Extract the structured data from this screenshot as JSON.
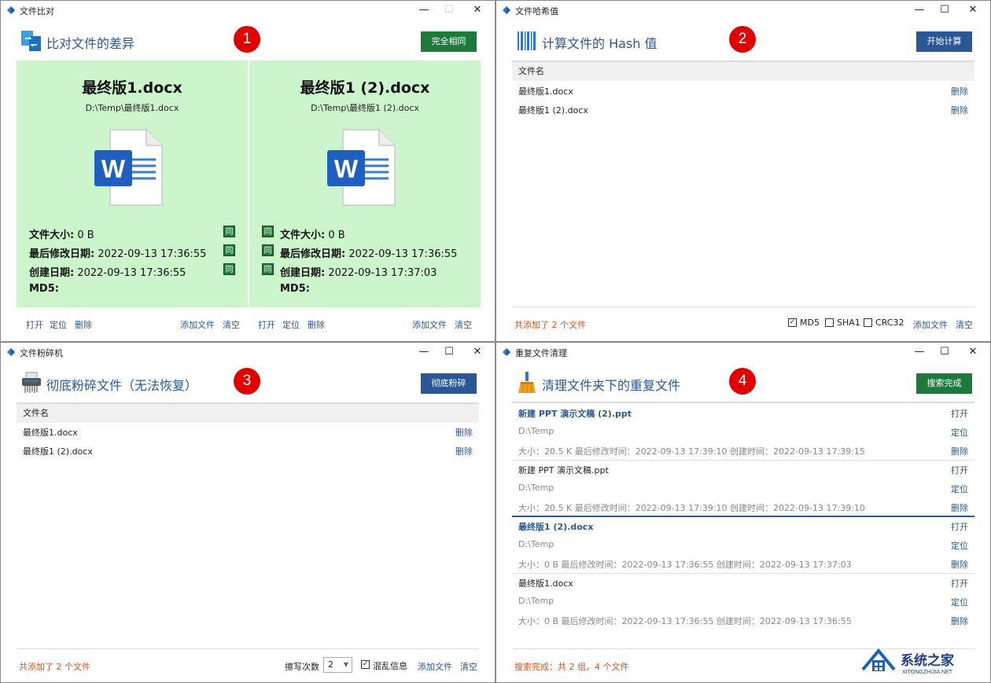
{
  "w1": {
    "title": "文件比对",
    "heading": "比对文件的差异",
    "badge": "1",
    "button": "完全相同",
    "left": {
      "file_name": "最终版1.docx",
      "path": "D:\\Temp\\最终版1.docx",
      "size_label": "文件大小:",
      "size_value": "0 B",
      "modified_label": "最后修改日期:",
      "modified_value": "2022-09-13  17:36:55",
      "created_label": "创建日期:",
      "created_value": "2022-09-13  17:36:55",
      "md5_label": "MD5:"
    },
    "right": {
      "file_name": "最终版1 (2).docx",
      "path": "D:\\Temp\\最终版1 (2).docx",
      "size_label": "文件大小:",
      "size_value": "0 B",
      "modified_label": "最后修改日期:",
      "modified_value": "2022-09-13  17:36:55",
      "created_label": "创建日期:",
      "created_value": "2022-09-13  17:37:03",
      "md5_label": "MD5:"
    },
    "same_mark": "同",
    "links": {
      "open": "打开",
      "locate": "定位",
      "delete": "删除",
      "add": "添加文件",
      "clear": "清空"
    }
  },
  "w2": {
    "title": "文件哈希值",
    "heading": "计算文件的 Hash 值",
    "badge": "2",
    "button": "开始计算",
    "column": "文件名",
    "rows": [
      "最终版1.docx",
      "最终版1 (2).docx"
    ],
    "delete": "删除",
    "status": "共添加了 2 个文件",
    "checks": [
      "MD5",
      "SHA1",
      "CRC32"
    ],
    "add": "添加文件",
    "clear": "清空"
  },
  "w3": {
    "title": "文件粉碎机",
    "heading": "彻底粉碎文件（无法恢复）",
    "badge": "3",
    "button": "彻底粉碎",
    "column": "文件名",
    "rows": [
      "最终版1.docx",
      "最终版1 (2).docx"
    ],
    "delete": "删除",
    "status": "共添加了 2 个文件",
    "erase_label": "擦写次数",
    "erase_value": "2",
    "mix_label": "混乱信息",
    "add": "添加文件",
    "clear": "清空"
  },
  "w4": {
    "title": "重复文件清理",
    "heading": "清理文件夹下的重复文件",
    "badge": "4",
    "button": "搜索完成",
    "items": [
      {
        "name": "新建 PPT 演示文稿 (2).ppt",
        "path": "D:\\Temp",
        "meta": "大小：20.5 K      最后修改时间：2022-09-13  17:39:10      创建时间：2022-09-13  17:39:15"
      },
      {
        "name": "新建 PPT 演示文稿.ppt",
        "path": "D:\\Temp",
        "meta": "大小：20.5 K      最后修改时间：2022-09-13  17:39:10      创建时间：2022-09-13  17:39:10"
      },
      {
        "name": "最终版1 (2).docx",
        "path": "D:\\Temp",
        "meta": "大小：0 B      最后修改时间：2022-09-13  17:36:55      创建时间：2022-09-13  17:37:03"
      },
      {
        "name": "最终版1.docx",
        "path": "D:\\Temp",
        "meta": "大小：0 B      最后修改时间：2022-09-13  17:36:55      创建时间：2022-09-13  17:36:55"
      }
    ],
    "open": "打开",
    "locate": "定位",
    "delete": "删除",
    "status": "搜索完成：共 2 组，4 个文件",
    "watermark": "系统之家",
    "watermark_url": "XITONGZHIJIA.NET"
  },
  "window_controls": {
    "min": "—",
    "max": "☐",
    "close": "✕"
  }
}
